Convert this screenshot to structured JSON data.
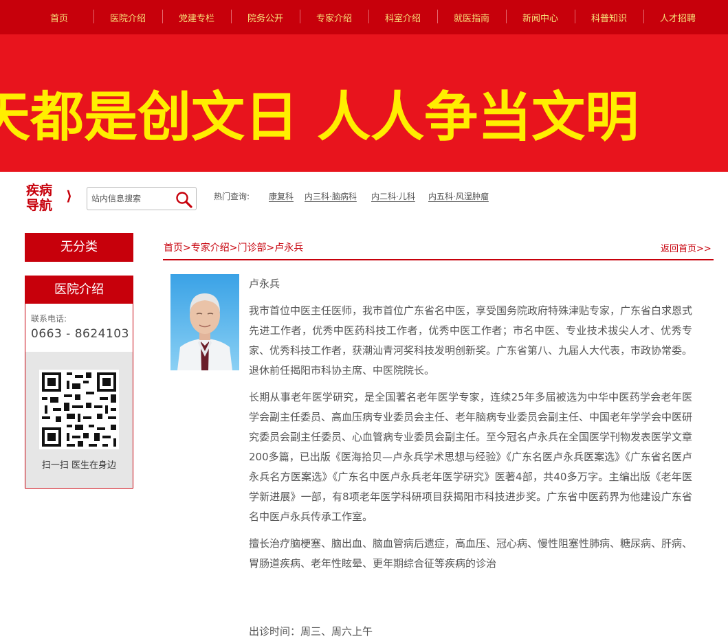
{
  "nav": [
    "首页",
    "医院介绍",
    "党建专栏",
    "院务公开",
    "专家介绍",
    "科室介绍",
    "就医指南",
    "新闻中心",
    "科普知识",
    "人才招聘"
  ],
  "banner": {
    "slogan": "天都是创文日    人人争当文明"
  },
  "search": {
    "logo_line1": "疾病",
    "logo_line2": "导航",
    "logo_arrow": "⟩",
    "placeholder": "站内信息搜索",
    "hot_label": "热门查询:",
    "hot_links": [
      "康复科",
      "内三科·脑病科",
      "内二科·儿科",
      "内五科·风湿肿瘤"
    ]
  },
  "sidebar": {
    "category_button": "无分类",
    "box_title": "医院介绍",
    "contact_label": "联系电话:",
    "contact_phone": "0663 - 8624103",
    "qr_caption": "扫一扫   医生在身边"
  },
  "breadcrumb": {
    "home": "首页",
    "sep": ">",
    "l2": "专家介绍",
    "l3": "门诊部",
    "l4": "卢永兵"
  },
  "back_home": "返回首页>>",
  "doctor": {
    "name": "卢永兵",
    "para1": "我市首位中医主任医师，我市首位广东省名中医，享受国务院政府特殊津贴专家，广东省白求恩式先进工作者，优秀中医药科技工作者，优秀中医工作者；市名中医、专业技术拔尖人才、优秀专家、优秀科技工作者，获潮汕青河奖科技发明创新奖。广东省第八、九届人大代表，市政协常委。退休前任揭阳市科协主席、中医院院长。",
    "para2": "长期从事老年医学研究，是全国著名老年医学专家，连续25年多届被选为中华中医药学会老年医学会副主任委员、高血压病专业委员会主任、老年脑病专业委员会副主任、中国老年学学会中医研究委员会副主任委员、心血管病专业委员会副主任。至今冠名卢永兵在全国医学刊物发表医学文章200多篇，已出版《医海拾贝—卢永兵学术思想与经验》《广东名医卢永兵医案选》《广东省名医卢永兵名方医案选》《广东名中医卢永兵老年医学研究》医著4部，共40多万字。主编出版《老年医学新进展》一部，有8项老年医学科研项目获揭阳市科技进步奖。广东省中医药界为他建设广东省名中医卢永兵传承工作室。",
    "para3": "擅长治疗脑梗塞、脑出血、脑血管病后遗症，高血压、冠心病、慢性阻塞性肺病、糖尿病、肝病、胃肠道疾病、老年性眩晕、更年期综合征等疾病的诊治",
    "clinic_time": "出诊时间：周三、周六上午"
  },
  "colors": {
    "brand_red": "#c7000b",
    "banner_red": "#e8141d",
    "nav_text": "#f7e27a",
    "slogan": "#ffee00"
  }
}
